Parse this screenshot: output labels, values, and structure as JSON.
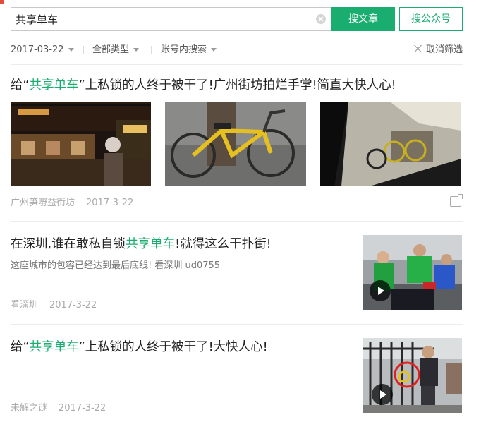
{
  "search": {
    "query": "共享单车",
    "article_button": "搜文章",
    "account_button": "搜公众号"
  },
  "filters": {
    "date": "2017-03-22",
    "type": "全部类型",
    "scope": "账号内搜索",
    "cancel": "取消筛选"
  },
  "results": [
    {
      "title_pre": "给“",
      "title_hl": "共享单车",
      "title_post": "”上私锁的人终于被干了!广州街坊拍烂手掌!简直大快人心!",
      "source": "广州笋嘢益街坊",
      "date": "2017-3-22"
    },
    {
      "title_pre": "在深圳,谁在敢私自锁",
      "title_hl": "共享单车",
      "title_post": "!就得这么干扑街!",
      "desc": "这座城市的包容已经达到最后底线! 看深圳 ud0755",
      "source": "看深圳",
      "date": "2017-3-22"
    },
    {
      "title_pre": "给“",
      "title_hl": "共享单车",
      "title_post": "”上私锁的人终于被干了!大快人心!",
      "source": "未解之谜",
      "date": "2017-3-22"
    }
  ],
  "colors": {
    "accent": "#1aad70",
    "logo": "#e64a3b"
  },
  "icons": [
    "clear-icon",
    "caret-down-icon",
    "close-icon",
    "share-icon",
    "play-icon"
  ]
}
